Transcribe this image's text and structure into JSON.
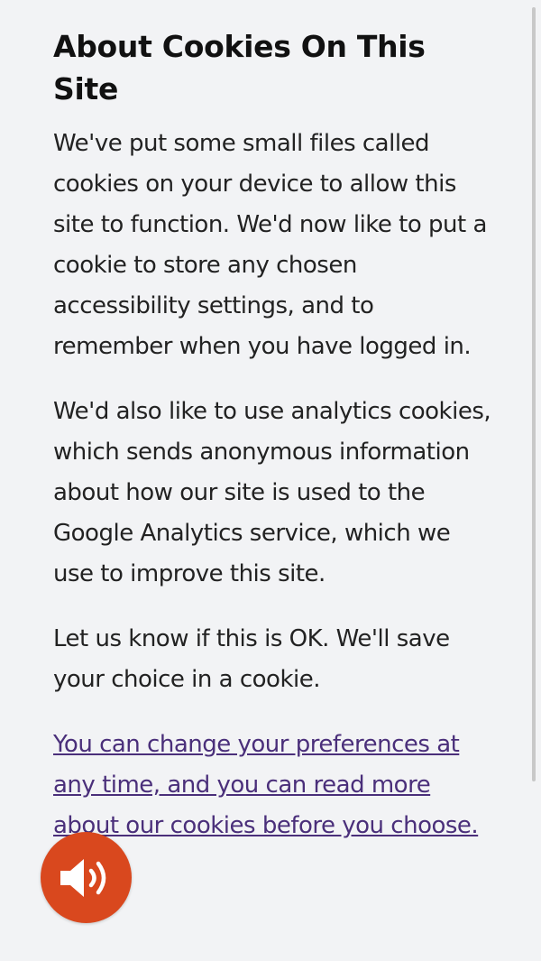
{
  "dialog": {
    "title": "About Cookies On This Site",
    "paragraphs": [
      "We've put some small files called cookies on your device to allow this site to function. We'd now like to put a cookie to store any chosen accessibility settings, and to remember when you have logged in.",
      "We'd also like to use analytics cookies, which sends anonymous information about how our site is used to the Google Analytics service, which we use to improve this site.",
      "Let us know if this is OK. We'll save your choice in a cookie."
    ],
    "preferences_link": "You can change your preferences at any time, and you can read more about our cookies before you choose."
  },
  "audio_button": {
    "icon": "speaker-icon",
    "color": "#d9481e"
  },
  "colors": {
    "background": "#f2f3f5",
    "text": "#222222",
    "link": "#4a2f7a"
  }
}
